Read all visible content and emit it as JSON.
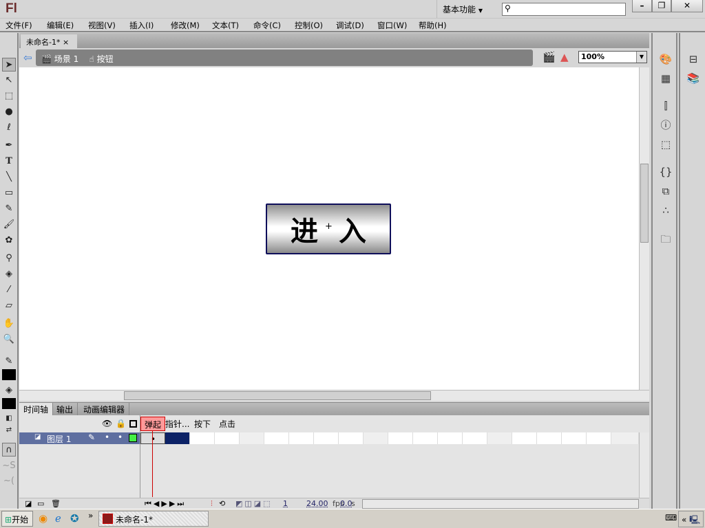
{
  "app": {
    "logo": "Fl",
    "workspace": "基本功能",
    "search_placeholder": "",
    "min": "–",
    "restore": "❐",
    "close": "✕"
  },
  "menu": [
    "文件(F)",
    "编辑(E)",
    "视图(V)",
    "插入(I)",
    "修改(M)",
    "文本(T)",
    "命令(C)",
    "控制(O)",
    "调试(D)",
    "窗口(W)",
    "帮助(H)"
  ],
  "document": {
    "tab": "未命名-1*",
    "tab_close": "×",
    "scene": "场景 1",
    "symbol": "按钮",
    "zoom": "100%"
  },
  "stage": {
    "button_text_left": "进",
    "button_text_right": "入",
    "registration": "+"
  },
  "timeline": {
    "tabs": [
      "时间轴",
      "输出",
      "动画编辑器"
    ],
    "frames": [
      "弹起",
      "指针...",
      "按下",
      "点击"
    ],
    "layer": "图层 1",
    "current_frame": "1",
    "fps": "24.00",
    "fps_unit": "fps",
    "time": "0.0",
    "time_unit": "s"
  },
  "taskbar": {
    "start": "开始",
    "window": "未命名-1*",
    "more": "»",
    "tray_arrow": "«"
  },
  "colors": {
    "layer_selected": "#5f6fa0",
    "keyframe_span": "#0c2266",
    "current_frame_label": "#ff9a9a",
    "playhead": "#cc0000"
  }
}
